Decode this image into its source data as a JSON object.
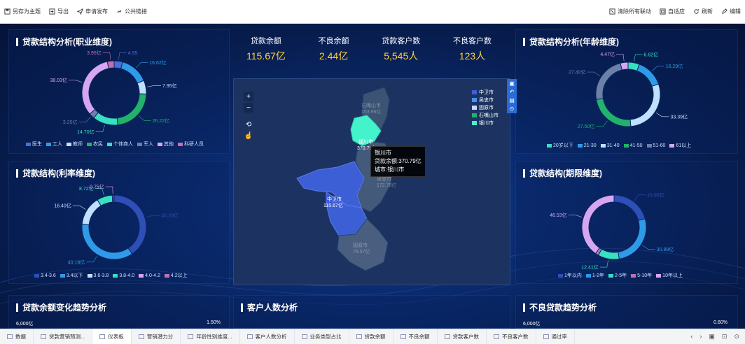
{
  "toolbar": {
    "left": [
      {
        "label": "另存为主题",
        "icon": "save-icon"
      },
      {
        "label": "导出",
        "icon": "export-icon"
      },
      {
        "label": "申请发布",
        "icon": "send-icon"
      },
      {
        "label": "公共链接",
        "icon": "link-icon"
      }
    ],
    "right": [
      {
        "label": "清除所有联动",
        "icon": "clear-link-icon"
      },
      {
        "label": "自适应",
        "icon": "fit-icon"
      },
      {
        "label": "刷新",
        "icon": "refresh-icon"
      },
      {
        "label": "编辑",
        "icon": "edit-icon"
      }
    ]
  },
  "kpis": [
    {
      "label": "贷款余额",
      "value": "115.67亿"
    },
    {
      "label": "不良余额",
      "value": "2.44亿"
    },
    {
      "label": "贷款客户数",
      "value": "5,545人"
    },
    {
      "label": "不良客户数",
      "value": "123人"
    }
  ],
  "panels": {
    "occupation": {
      "title": "贷款结构分析(职业维度)"
    },
    "age": {
      "title": "贷款结构分析(年龄维度)"
    },
    "rate": {
      "title": "贷款结构(利率维度)"
    },
    "term": {
      "title": "贷款结构(期限维度)"
    },
    "balance_trend": {
      "title": "贷款余额变化趋势分析",
      "left_axis": "6,000亿",
      "right_axis": "1.50%"
    },
    "customers": {
      "title": "客户人数分析"
    },
    "npl_trend": {
      "title": "不良贷款趋势分析",
      "left_axis": "6,000亿",
      "right_axis": "0.60%"
    }
  },
  "chart_data": [
    {
      "type": "pie",
      "title": "贷款结构分析(职业维度)",
      "categories": [
        "医生",
        "工人",
        "教师",
        "农民",
        "个体商人",
        "军人",
        "其他",
        "科研人员"
      ],
      "values": [
        4.95,
        16.62,
        7.95,
        26.22,
        14.7,
        3.25,
        38.03,
        3.95
      ],
      "value_labels": [
        "4.95",
        "16.62亿",
        "7.95亿",
        "26.22亿",
        "14.70亿",
        "3.25亿",
        "38.03亿",
        "3.95亿"
      ],
      "colors": [
        "#4a6fd6",
        "#2f9be8",
        "#bfe0ff",
        "#21b36b",
        "#37e0c0",
        "#6c80a8",
        "#d7a6f2",
        "#c46fb0"
      ]
    },
    {
      "type": "pie",
      "title": "贷款结构分析(年龄维度)",
      "categories": [
        "20岁以下",
        "21-30",
        "31-40",
        "41-50",
        "51-60",
        "61以上"
      ],
      "values": [
        6.62,
        16.29,
        33.39,
        27.5,
        27.4,
        4.47
      ],
      "value_labels": [
        "6.62亿",
        "16.29亿",
        "33.39亿",
        "27.50亿",
        "27.40亿",
        "4.47亿"
      ],
      "colors": [
        "#37e0c0",
        "#2f9be8",
        "#bfe0ff",
        "#21b36b",
        "#6c80a8",
        "#d7a6f2"
      ]
    },
    {
      "type": "pie",
      "title": "贷款结构(利率维度)",
      "categories": [
        "3.4-3.6",
        "3.4以下",
        "3.6-3.8",
        "3.8-4.0",
        "4.0-4.2",
        "4.2以上"
      ],
      "values": [
        45.29,
        40.18,
        16.4,
        8.72,
        0.75,
        0.3
      ],
      "value_labels": [
        "45.29亿",
        "40.18亿",
        "16.40亿",
        "8.72亿",
        "0.75亿",
        ""
      ],
      "colors": [
        "#2e4fb8",
        "#2f9be8",
        "#bfe0ff",
        "#37e0c0",
        "#d7a6f2",
        "#c46fb0"
      ]
    },
    {
      "type": "pie",
      "title": "贷款结构(期限维度)",
      "categories": [
        "1年以内",
        "1-2年",
        "2-5年",
        "5-10年",
        "10年以上"
      ],
      "values": [
        23.95,
        30.89,
        12.41,
        1.8,
        46.53
      ],
      "value_labels": [
        "23.95亿",
        "30.89亿",
        "12.41亿",
        "",
        "46.53亿"
      ],
      "colors": [
        "#2e4fb8",
        "#2f9be8",
        "#37e0c0",
        "#c46fb0",
        "#d7a6f2"
      ]
    }
  ],
  "map": {
    "legend": [
      {
        "label": "中卫市",
        "color": "#3d5fd6"
      },
      {
        "label": "吴忠市",
        "color": "#4a8ff0"
      },
      {
        "label": "固原市",
        "color": "#c6d8ff"
      },
      {
        "label": "石嘴山市",
        "color": "#21b36b"
      },
      {
        "label": "银川市",
        "color": "#44f2cc"
      }
    ],
    "regions": [
      {
        "name": "石嘴山市",
        "value": "153.96亿"
      },
      {
        "name": "银川市",
        "value": "370.79亿"
      },
      {
        "name": "吴忠市",
        "value": "172.78亿"
      },
      {
        "name": "中卫市",
        "value": "115.67亿"
      },
      {
        "name": "固原市",
        "value": "76.57亿"
      }
    ],
    "tooltip": {
      "line1": "银川市",
      "line2": "贷款余额:370.79亿",
      "line3": "城市:银川市"
    },
    "zoom_in": "+",
    "zoom_out": "−"
  },
  "tabs": [
    {
      "label": "数据",
      "active": false
    },
    {
      "label": "贷款营销预测...",
      "active": false
    },
    {
      "label": "仪表板",
      "active": true
    },
    {
      "label": "营销潜力分",
      "active": false
    },
    {
      "label": "年龄性别维度...",
      "active": false
    },
    {
      "label": "客户人数分析",
      "active": false
    },
    {
      "label": "业务类型占比",
      "active": false
    },
    {
      "label": "贷款余额",
      "active": false
    },
    {
      "label": "不良余额",
      "active": false
    },
    {
      "label": "贷款客户数",
      "active": false
    },
    {
      "label": "不良客户数",
      "active": false
    },
    {
      "label": "通过率",
      "active": false
    }
  ]
}
